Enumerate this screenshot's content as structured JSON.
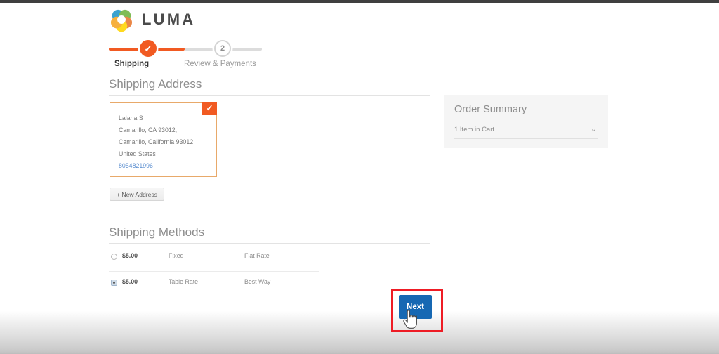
{
  "brand": {
    "name": "LUMA",
    "logo_icon": "luma-rings-logo",
    "logo_colors": [
      "#2196c9",
      "#6eb33e",
      "#f5a623",
      "#e8772e",
      "#ffd400"
    ]
  },
  "progress": {
    "steps": [
      {
        "label": "Shipping",
        "state": "complete",
        "icon": "check-icon",
        "number": ""
      },
      {
        "label": "Review & Payments",
        "state": "upcoming",
        "icon": "",
        "number": "2"
      }
    ],
    "done_color": "#f15a22",
    "todo_color": "#dcdcdc"
  },
  "shipping_address": {
    "title": "Shipping Address",
    "selected_card": {
      "selected_icon": "check-icon",
      "name": "Lalana S",
      "line1": "Camarillo, CA 93012,",
      "line2": "Camarillo, California 93012",
      "country": "United States",
      "phone": "8054821996",
      "border_color": "#e8a96a",
      "badge_color": "#f15a22",
      "phone_color": "#5c8fd0"
    },
    "new_address_button": "+ New Address"
  },
  "shipping_methods": {
    "title": "Shipping Methods",
    "columns": [
      "select",
      "price",
      "carrier",
      "method"
    ],
    "rows": [
      {
        "selected": false,
        "price": "$5.00",
        "carrier": "Fixed",
        "method": "Flat Rate"
      },
      {
        "selected": true,
        "price": "$5.00",
        "carrier": "Table Rate",
        "method": "Best Way"
      }
    ]
  },
  "order_summary": {
    "title": "Order Summary",
    "cart_summary": "1 Item in Cart",
    "toggle_icon": "chevron-down-icon",
    "panel_color": "#f5f5f5"
  },
  "actions": {
    "next_button": "Next",
    "next_button_color": "#1668b3",
    "annotation_color": "#ee1c25",
    "cursor_icon": "pointing-hand-cursor"
  }
}
